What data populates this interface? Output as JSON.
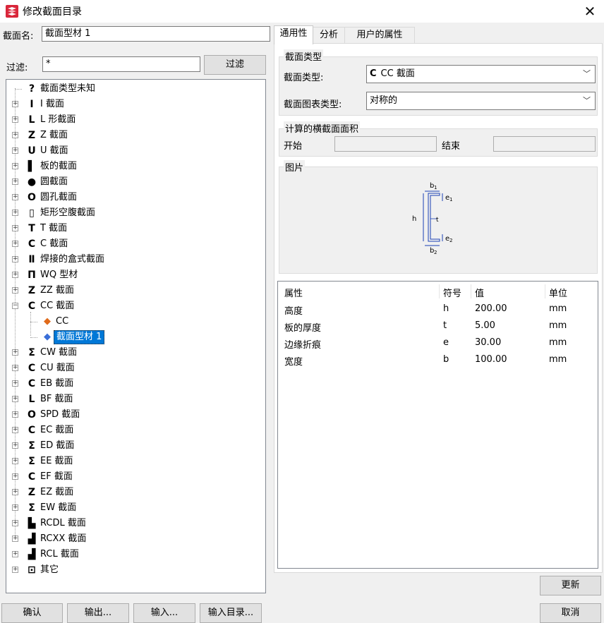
{
  "window": {
    "title": "修改截面目录",
    "close_glyph": "✕"
  },
  "section_name": {
    "label": "截面名:",
    "value": "截面型材 1"
  },
  "filter": {
    "label": "过滤:",
    "value": "*",
    "button_label": "过滤"
  },
  "tree": {
    "items": [
      {
        "label": "截面类型未知",
        "icon": "?"
      },
      {
        "label": "I 截面",
        "icon": "I"
      },
      {
        "label": "L 形截面",
        "icon": "L"
      },
      {
        "label": "Z 截面",
        "icon": "Z"
      },
      {
        "label": "U 截面",
        "icon": "U"
      },
      {
        "label": "板的截面",
        "icon": "▌"
      },
      {
        "label": "圆截面",
        "icon": "●"
      },
      {
        "label": "圆孔截面",
        "icon": "O"
      },
      {
        "label": "矩形空腹截面",
        "icon": "▯"
      },
      {
        "label": "T 截面",
        "icon": "T"
      },
      {
        "label": "C 截面",
        "icon": "C"
      },
      {
        "label": "焊接的盒式截面",
        "icon": "Ⅱ"
      },
      {
        "label": "WQ 型材",
        "icon": "Π"
      },
      {
        "label": "ZZ 截面",
        "icon": "Z"
      },
      {
        "label": "CC 截面",
        "icon": "C"
      },
      {
        "label": "CC",
        "icon": "◆"
      },
      {
        "label": "截面型材 1",
        "icon": "◆"
      },
      {
        "label": "CW 截面",
        "icon": "Σ"
      },
      {
        "label": "CU 截面",
        "icon": "C"
      },
      {
        "label": "EB 截面",
        "icon": "C"
      },
      {
        "label": "BF 截面",
        "icon": "L"
      },
      {
        "label": "SPD 截面",
        "icon": "O"
      },
      {
        "label": "EC 截面",
        "icon": "C"
      },
      {
        "label": "ED 截面",
        "icon": "Σ"
      },
      {
        "label": "EE 截面",
        "icon": "Σ"
      },
      {
        "label": "EF 截面",
        "icon": "C"
      },
      {
        "label": "EZ 截面",
        "icon": "Z"
      },
      {
        "label": "EW 截面",
        "icon": "Σ"
      },
      {
        "label": "RCDL 截面",
        "icon": "▙"
      },
      {
        "label": "RCXX 截面",
        "icon": "▟"
      },
      {
        "label": "RCL 截面",
        "icon": "▟"
      },
      {
        "label": "其它",
        "icon": "⊡"
      }
    ]
  },
  "tabs": [
    "通用性",
    "分析",
    "用户的属性"
  ],
  "general": {
    "section_type_group": "截面类型",
    "section_type_label": "截面类型:",
    "section_type_value": "CC 截面",
    "section_type_icon": "C",
    "chart_type_label": "截面图表类型:",
    "chart_type_value": "对称的",
    "area_group": "计算的横截面面积",
    "start_label": "开始",
    "end_label": "结束",
    "picture_group": "图片",
    "diagram": {
      "h": "h",
      "t": "t",
      "b1": "b",
      "b1_sub": "1",
      "b2": "b",
      "b2_sub": "2",
      "e1": "e",
      "e1_sub": "1",
      "e2": "e",
      "e2_sub": "2"
    }
  },
  "properties": {
    "headers": {
      "name": "属性",
      "symbol": "符号",
      "value": "值",
      "unit": "单位"
    },
    "rows": [
      {
        "name": "高度",
        "symbol": "h",
        "value": "200.00",
        "unit": "mm"
      },
      {
        "name": "板的厚度",
        "symbol": "t",
        "value": "5.00",
        "unit": "mm"
      },
      {
        "name": "边缘折痕",
        "symbol": "e",
        "value": "30.00",
        "unit": "mm"
      },
      {
        "name": "宽度",
        "symbol": "b",
        "value": "100.00",
        "unit": "mm"
      }
    ]
  },
  "buttons": {
    "update": "更新",
    "ok": "确认",
    "export": "输出...",
    "import": "输入...",
    "import_catalog": "输入目录...",
    "cancel": "取消"
  },
  "colors": {
    "selection": "#0078d7",
    "diagram_blue": "#1a3fb5",
    "window_bg": "#f0f0f0"
  }
}
